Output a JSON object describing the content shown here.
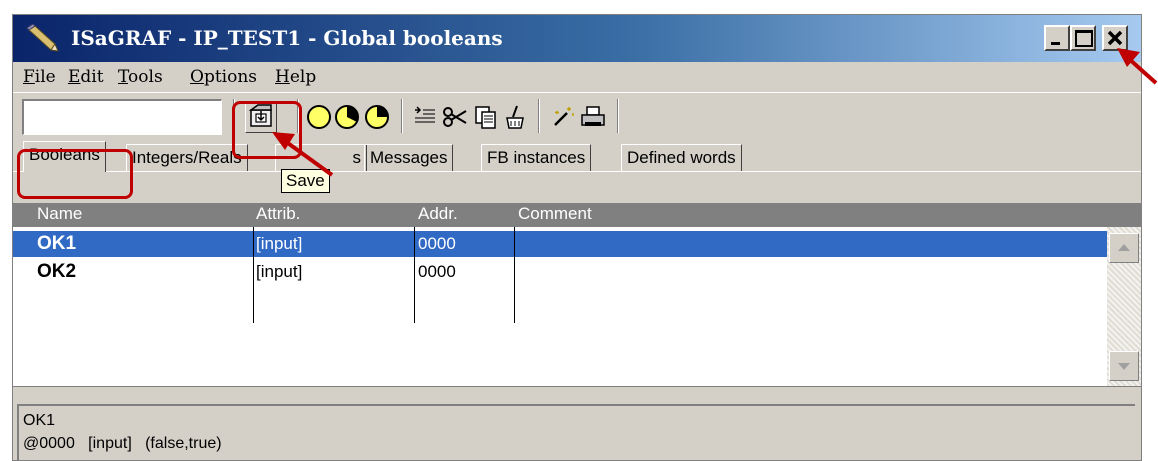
{
  "window": {
    "title": "ISaGRAF - IP_TEST1 - Global booleans",
    "controls": {
      "minimize_icon": "minimize-icon",
      "maximize_icon": "maximize-icon",
      "close_icon": "close-icon"
    }
  },
  "menu": {
    "items": [
      {
        "accel": "F",
        "rest": "ile"
      },
      {
        "accel": "E",
        "rest": "dit"
      },
      {
        "accel": "T",
        "rest": "ools"
      },
      {
        "accel": "O",
        "rest": "ptions"
      },
      {
        "accel": "H",
        "rest": "elp"
      }
    ]
  },
  "toolbar": {
    "input_value": "",
    "buttons": [
      "save-icon",
      "yellow-circle-icon",
      "circle-half-icon",
      "circle-quarter-icon",
      "indent-icon",
      "cut-icon",
      "copy-icon",
      "paste-icon",
      "magic-wand-icon",
      "print-icon"
    ]
  },
  "tooltip": {
    "text": "Save"
  },
  "tabs": {
    "items": [
      "Booleans",
      "Integers/Reals",
      "s",
      "Messages",
      "FB instances",
      "Defined words"
    ],
    "active": "Booleans"
  },
  "grid": {
    "columns": [
      "Name",
      "Attrib.",
      "Addr.",
      "Comment"
    ],
    "rows": [
      {
        "name": "OK1",
        "attrib": "[input]",
        "addr": "0000",
        "comment": ""
      },
      {
        "name": "OK2",
        "attrib": "[input]",
        "addr": "0000",
        "comment": ""
      }
    ],
    "selected_row": 0
  },
  "info": {
    "lines": [
      "OK1",
      "@0000   [input]   (false,true)"
    ]
  },
  "colors": {
    "titlebar_start": "#0a246a",
    "titlebar_end": "#a6caf0",
    "selection": "#316ac5",
    "face": "#d4d0c8",
    "annotation": "#c00000"
  }
}
